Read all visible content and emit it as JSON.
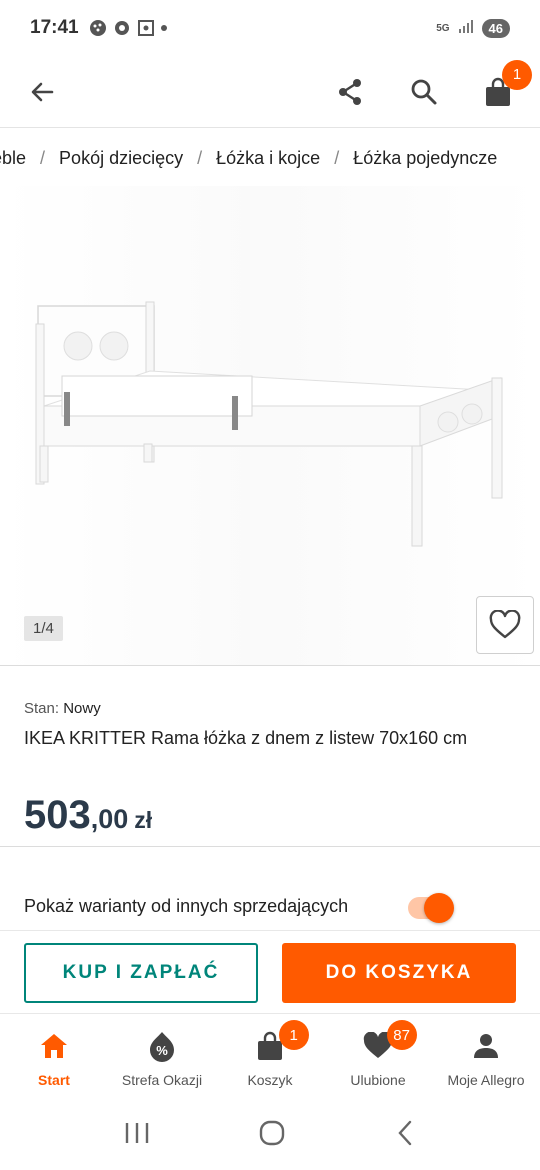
{
  "status": {
    "time": "17:41",
    "network": "5G",
    "battery": "46"
  },
  "header": {
    "cart_badge": "1"
  },
  "breadcrumb": [
    "eble",
    "Pokój dziecięcy",
    "Łóżka i kojce",
    "Łóżka pojedyncze"
  ],
  "gallery": {
    "counter": "1/4"
  },
  "product": {
    "condition_label": "Stan:",
    "condition_value": "Nowy",
    "title": "IKEA KRITTER Rama łóżka z dnem z listew 70x160 cm",
    "price_main": "503",
    "price_frac": ",00",
    "price_currency": "zł"
  },
  "variants": {
    "label": "Pokaż warianty od innych sprzedających",
    "enabled": true
  },
  "actions": {
    "buy_label": "KUP I ZAPŁAĆ",
    "cart_label": "DO KOSZYKA"
  },
  "nav": [
    {
      "label": "Start",
      "badge": ""
    },
    {
      "label": "Strefa Okazji",
      "badge": ""
    },
    {
      "label": "Koszyk",
      "badge": "1"
    },
    {
      "label": "Ulubione",
      "badge": "87"
    },
    {
      "label": "Moje Allegro",
      "badge": ""
    }
  ],
  "colors": {
    "accent": "#ff5a00",
    "teal": "#00857a",
    "price": "#2b3a4a"
  }
}
